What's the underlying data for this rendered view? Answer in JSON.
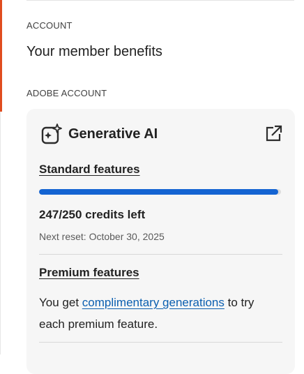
{
  "sections": {
    "account_label": "ACCOUNT",
    "benefits_title": "Your member benefits",
    "adobe_account_label": "ADOBE ACCOUNT"
  },
  "card": {
    "title": "Generative AI",
    "title_icon": "generative-ai-icon",
    "open_icon": "open-in-new-icon",
    "standard": {
      "label": "Standard features",
      "credits_used": 247,
      "credits_total": 250,
      "credits_text": "247/250 credits left",
      "reset_text": "Next reset: October 30, 2025"
    },
    "premium": {
      "label": "Premium features",
      "body_prefix": "You get ",
      "link_text": "complimentary generations",
      "body_suffix": " to try each premium feature."
    }
  },
  "colors": {
    "accent": "#e04d1f",
    "progress": "#1464d2",
    "link": "#0b5fb0",
    "card_bg": "#f6f6f6"
  }
}
